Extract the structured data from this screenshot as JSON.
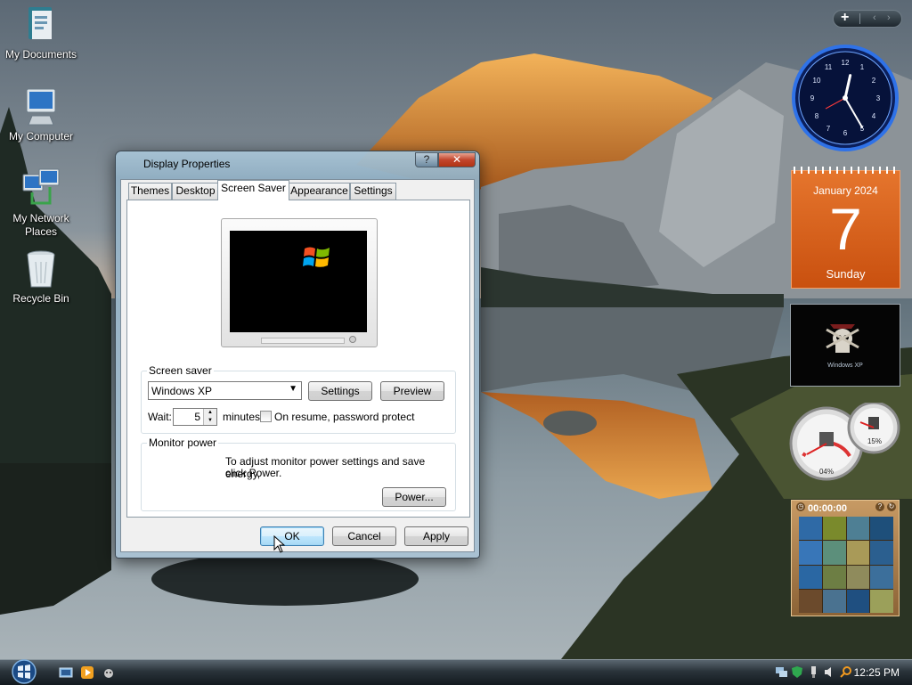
{
  "desktop": {
    "icons": [
      {
        "label": "My Documents",
        "icon": "folder-icon"
      },
      {
        "label": "My Computer",
        "icon": "computer-icon"
      },
      {
        "label": "My Network Places",
        "icon": "network-icon"
      },
      {
        "label": "Recycle Bin",
        "icon": "recycle-bin-icon"
      }
    ]
  },
  "sidebar": {
    "add_glyph": "+",
    "prev_glyph": "‹",
    "next_glyph": "›",
    "clock": {
      "hour": 12,
      "minute": 25
    },
    "calendar": {
      "month": "January 2024",
      "day": "7",
      "weekday": "Sunday"
    },
    "slideshow": {
      "caption": "Windows XP"
    },
    "meter": {
      "cpu_percent": "04%",
      "memory_percent": "15%"
    },
    "puzzle": {
      "timer": "00:00:00",
      "help_glyph": "?"
    }
  },
  "dialog": {
    "title": "Display Properties",
    "help_glyph": "?",
    "close_glyph": "✕",
    "tabs": [
      {
        "label": "Themes",
        "active": false
      },
      {
        "label": "Desktop",
        "active": false
      },
      {
        "label": "Screen Saver",
        "active": true
      },
      {
        "label": "Appearance",
        "active": false
      },
      {
        "label": "Settings",
        "active": false
      }
    ],
    "screensaver": {
      "group_label": "Screen saver",
      "selected": "Windows XP",
      "settings_button": "Settings",
      "preview_button": "Preview",
      "wait_label": "Wait:",
      "wait_value": "5",
      "minutes_label": "minutes",
      "resume_label": "On resume, password protect",
      "resume_checked": false
    },
    "monitor_power": {
      "group_label": "Monitor power",
      "text_line1": "To adjust monitor power settings and save energy,",
      "text_line2": "click Power.",
      "power_button": "Power..."
    },
    "buttons": {
      "ok": "OK",
      "cancel": "Cancel",
      "apply": "Apply"
    }
  },
  "taskbar": {
    "clock": "12:25 PM"
  }
}
